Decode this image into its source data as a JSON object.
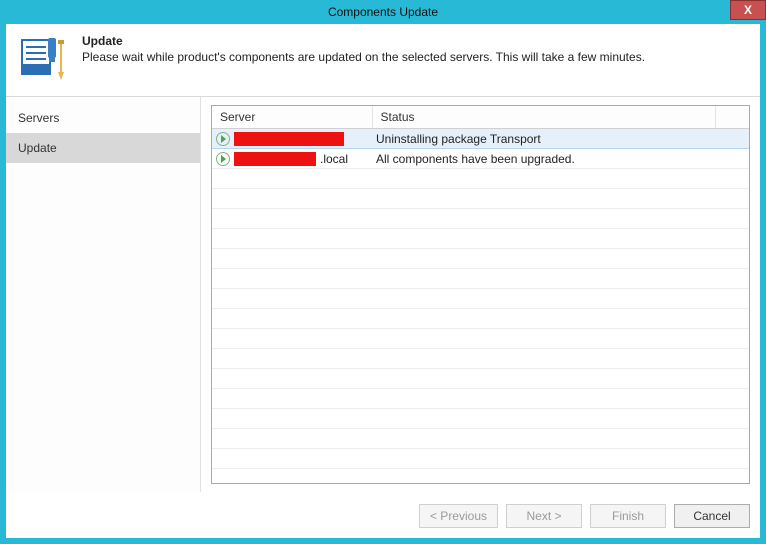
{
  "window": {
    "title": "Components Update",
    "close_glyph": "X"
  },
  "header": {
    "title": "Update",
    "description": "Please wait while product's components are updated on the selected servers. This will take a few minutes."
  },
  "sidebar": {
    "items": [
      {
        "label": "Servers",
        "active": false
      },
      {
        "label": "Update",
        "active": true
      }
    ]
  },
  "table": {
    "columns": {
      "server": "Server",
      "status": "Status"
    },
    "rows": [
      {
        "server_suffix": "",
        "status": "Uninstalling package Transport",
        "highlight": true,
        "redact_width": 110
      },
      {
        "server_suffix": ".local",
        "status": "All components have been upgraded.",
        "highlight": false,
        "redact_width": 82
      }
    ]
  },
  "footer": {
    "previous": "< Previous",
    "next": "Next >",
    "finish": "Finish",
    "cancel": "Cancel"
  }
}
